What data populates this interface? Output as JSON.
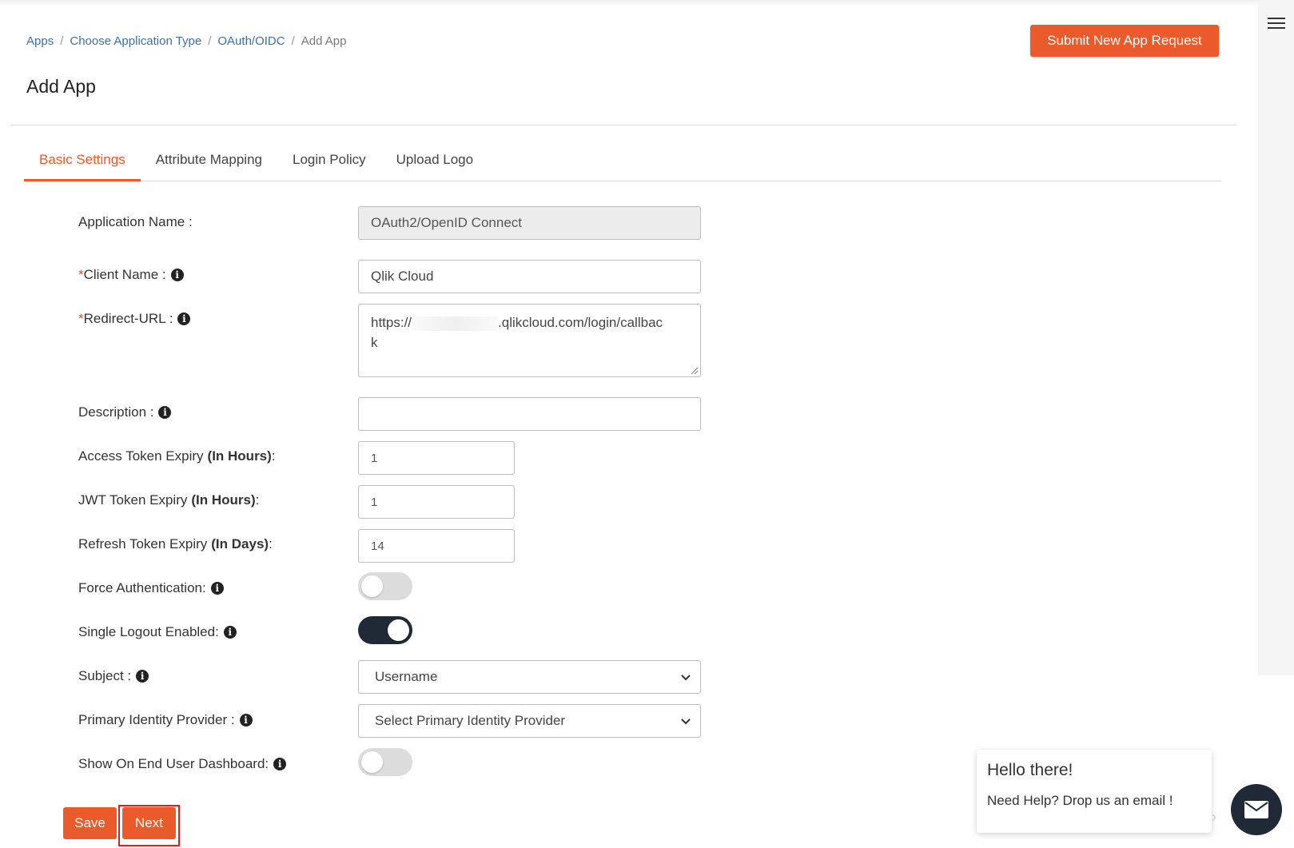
{
  "breadcrumb": {
    "items": [
      "Apps",
      "Choose Application Type",
      "OAuth/OIDC"
    ],
    "current": "Add App",
    "separator": "/"
  },
  "header": {
    "submit_button": "Submit New App Request",
    "title": "Add App"
  },
  "tabs": [
    "Basic Settings",
    "Attribute Mapping",
    "Login Policy",
    "Upload Logo"
  ],
  "form": {
    "application_name": {
      "label": "Application Name :",
      "value": "OAuth2/OpenID Connect"
    },
    "client_name": {
      "required_mark": "*",
      "label": "Client Name :",
      "value": "Qlik Cloud"
    },
    "redirect_url": {
      "required_mark": "*",
      "label": "Redirect-URL :",
      "value_prefix": "https://",
      "value_suffix": ".qlikcloud.com/login/callbac",
      "value_wrap": "k"
    },
    "description": {
      "label": "Description :",
      "value": ""
    },
    "access_token": {
      "label": "Access Token Expiry",
      "unit": "(In Hours)",
      "colon": ":",
      "value": "1"
    },
    "jwt_token": {
      "label": "JWT Token Expiry",
      "unit": "(In Hours)",
      "colon": ":",
      "value": "1"
    },
    "refresh_token": {
      "label": "Refresh Token Expiry",
      "unit": "(In Days)",
      "colon": ":",
      "value": "14"
    },
    "force_auth": {
      "label": "Force Authentication:",
      "enabled": false
    },
    "single_logout": {
      "label": "Single Logout Enabled:",
      "enabled": true
    },
    "subject": {
      "label": "Subject :",
      "selected": "Username"
    },
    "primary_idp": {
      "label": "Primary Identity Provider :",
      "selected": "Select Primary Identity Provider"
    },
    "show_dashboard": {
      "label": "Show On End User Dashboard:",
      "enabled": false
    }
  },
  "actions": {
    "save": "Save",
    "next": "Next"
  },
  "chat": {
    "greeting": "Hello there!",
    "message": "Need Help? Drop us an email !"
  },
  "icons": {
    "info": "info-icon",
    "menu": "hamburger-menu-icon",
    "mail": "mail-icon",
    "chevron": "chevron-down-icon"
  },
  "colors": {
    "accent": "#ea5a2b",
    "dark": "#1f2a36",
    "link": "#3d6fb0",
    "highlight": "#e02020"
  }
}
